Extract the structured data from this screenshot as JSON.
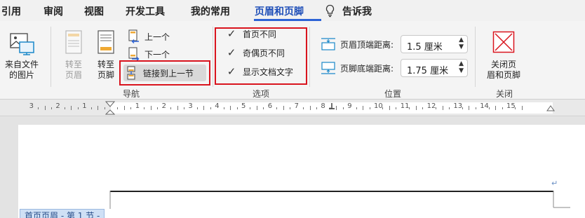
{
  "tabs": [
    "引用",
    "审阅",
    "视图",
    "开发工具",
    "我的常用",
    "页眉和页脚",
    "告诉我"
  ],
  "active_tab": "页眉和页脚",
  "ribbon": {
    "insert_picture": {
      "line1": "来自文件",
      "line2": "的图片"
    },
    "goto_header": {
      "line1": "转至",
      "line2": "页眉",
      "enabled": false
    },
    "goto_footer": {
      "line1": "转至",
      "line2": "页脚"
    },
    "previous": "上一个",
    "next": "下一个",
    "link_to_previous": "链接到上一节",
    "nav_group_label": "导航",
    "options": {
      "different_first_page": {
        "label": "首页不同",
        "checked": true
      },
      "different_odd_even": {
        "label": "奇偶页不同",
        "checked": true
      },
      "show_document_text": {
        "label": "显示文档文字",
        "checked": true
      }
    },
    "options_group_label": "选项",
    "position": {
      "header_from_top_label": "页眉顶端距离:",
      "header_from_top_value": "1.5 厘米",
      "footer_from_bottom_label": "页脚底端距离:",
      "footer_from_bottom_value": "1.75 厘米"
    },
    "position_group_label": "位置",
    "close": {
      "line1": "关闭页",
      "line2": "眉和页脚"
    },
    "close_group_label": "关闭"
  },
  "ruler": {
    "numbers": [
      "3",
      "2",
      "1",
      "1",
      "2",
      "3",
      "4",
      "5",
      "6",
      "7",
      "8",
      "9",
      "10",
      "11",
      "12",
      "13",
      "14",
      "15"
    ]
  },
  "document": {
    "header_tag": "首页页眉 - 第 1 节 -",
    "paragraph_mark": "↵"
  },
  "colors": {
    "accent": "#2c63d6",
    "highlight_box": "#d9141e",
    "close_icon": "#d9141e"
  }
}
